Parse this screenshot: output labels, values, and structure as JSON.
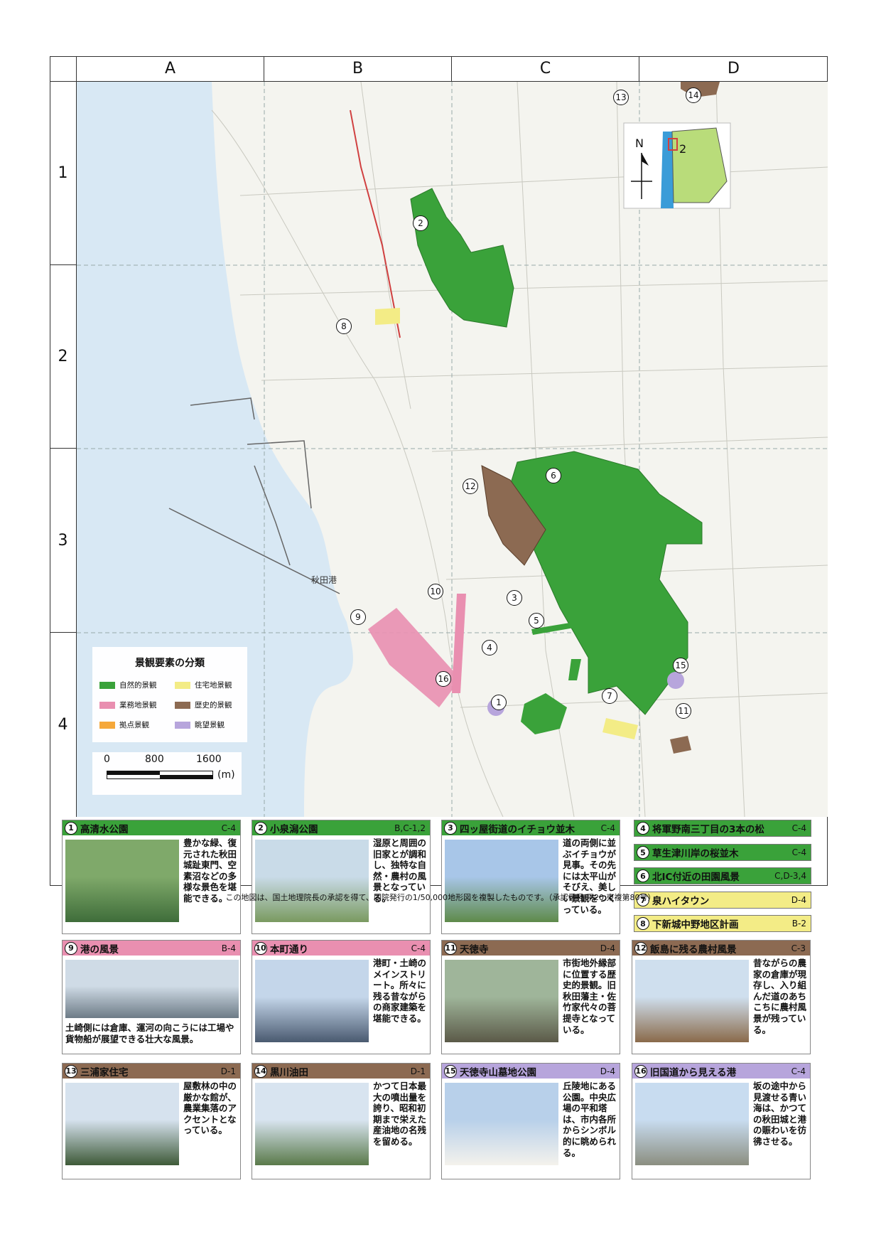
{
  "grid": {
    "columns": [
      "A",
      "B",
      "C",
      "D"
    ],
    "rows": [
      "1",
      "2",
      "3",
      "4"
    ]
  },
  "map": {
    "place_labels": {
      "port": "秋田港"
    },
    "markers": [
      "1",
      "2",
      "3",
      "4",
      "5",
      "6",
      "7",
      "8",
      "9",
      "10",
      "11",
      "12",
      "13",
      "14",
      "15",
      "16"
    ],
    "inset": {
      "north": "N",
      "number": "2"
    },
    "colors": {
      "sea": "#d8e8f4",
      "land": "#f4f4ef",
      "natural": "#3aa23a",
      "commercial": "#e98fb0",
      "hub": "#f5a83a",
      "residential": "#f3ec86",
      "historic": "#8c6a52",
      "view": "#b7a5dc"
    }
  },
  "legend": {
    "title": "景観要素の分類",
    "items": [
      {
        "label": "自然的景観",
        "color": "#3aa23a"
      },
      {
        "label": "住宅地景観",
        "color": "#f3ec86"
      },
      {
        "label": "業務地景観",
        "color": "#e98fb0"
      },
      {
        "label": "歴史的景観",
        "color": "#8c6a52"
      },
      {
        "label": "拠点景観",
        "color": "#f5a83a"
      },
      {
        "label": "眺望景観",
        "color": "#b7a5dc"
      }
    ]
  },
  "scale": {
    "ticks": [
      "0",
      "800",
      "1600"
    ],
    "unit": "(m)"
  },
  "panels": [
    {
      "num": "1",
      "name": "高清水公園",
      "grid": "C-4",
      "color": "#3aa23a",
      "text": "豊かな緑、復元された秋田城趾東門、空素沼などの多様な景色を堪能できる。"
    },
    {
      "num": "2",
      "name": "小泉潟公園",
      "grid": "B,C-1,2",
      "color": "#3aa23a",
      "text": "湿原と周囲の旧家とが調和し、独特な自然・農村の風景となっている。"
    },
    {
      "num": "3",
      "name": "四ッ屋街道のイチョウ並木",
      "grid": "C-4",
      "color": "#3aa23a",
      "text": "道の両側に並ぶイチョウが見事。その先には太平山がそびえ、美しい景観をつくっている。"
    },
    {
      "num": "9",
      "name": "港の風景",
      "grid": "B-4",
      "color": "#e98fb0",
      "text": "土崎側には倉庫、運河の向こうには工場や貨物船が展望できる壮大な風景。"
    },
    {
      "num": "10",
      "name": "本町通り",
      "grid": "C-4",
      "color": "#e98fb0",
      "text": "港町・土崎のメインストリート。所々に残る昔ながらの商家建築を堪能できる。"
    },
    {
      "num": "11",
      "name": "天徳寺",
      "grid": "D-4",
      "color": "#8c6a52",
      "text": "市街地外縁部に位置する歴史的景観。旧秋田藩主・佐竹家代々の菩提寺となっている。"
    },
    {
      "num": "12",
      "name": "飯島に残る農村風景",
      "grid": "C-3",
      "color": "#8c6a52",
      "text": "昔ながらの農家の倉庫が現存し、入り組んだ道のあちこちに農村風景が残っている。"
    },
    {
      "num": "13",
      "name": "三浦家住宅",
      "grid": "D-1",
      "color": "#8c6a52",
      "text": "屋敷林の中の厳かな館が、農業集落のアクセントとなっている。"
    },
    {
      "num": "14",
      "name": "黒川油田",
      "grid": "D-1",
      "color": "#8c6a52",
      "text": "かつて日本最大の噴出量を誇り、昭和初期まで栄えた産油地の名残を留める。"
    },
    {
      "num": "15",
      "name": "天徳寺山墓地公園",
      "grid": "D-4",
      "color": "#b7a5dc",
      "text": "丘陵地にある公園。中央広場の平和塔は、市内各所からシンボル的に眺められる。"
    },
    {
      "num": "16",
      "name": "旧国道から見える港",
      "grid": "C-4",
      "color": "#b7a5dc",
      "text": "坂の途中から見渡せる青い海は、かつての秋田城と港の賑わいを彷彿させる。"
    }
  ],
  "mini_panels": [
    {
      "num": "4",
      "name": "将軍野南三丁目の3本の松",
      "grid": "C-4",
      "color": "#3aa23a"
    },
    {
      "num": "5",
      "name": "草生津川岸の桜並木",
      "grid": "C-4",
      "color": "#3aa23a"
    },
    {
      "num": "6",
      "name": "北IC付近の田園風景",
      "grid": "C,D-3,4",
      "color": "#3aa23a"
    },
    {
      "num": "7",
      "name": "泉ハイタウン",
      "grid": "D-4",
      "color": "#f3ec86"
    },
    {
      "num": "8",
      "name": "下新城中野地区計画",
      "grid": "B-2",
      "color": "#f3ec86"
    }
  ],
  "footer_note": "この地図は、国土地理院長の承認を得て、同院発行の1/50,000地形図を複製したものです。（承認番号 平20 東複第80号）"
}
